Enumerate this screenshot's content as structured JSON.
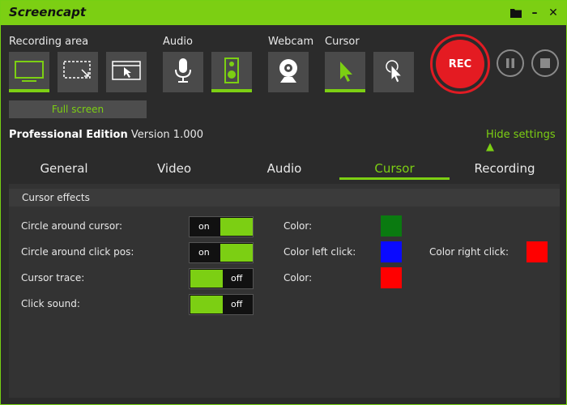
{
  "window": {
    "title": "Screencapt"
  },
  "titlebar": {
    "folder_icon": "folder-icon",
    "minimize": "–",
    "close": "✕"
  },
  "toolbar": {
    "recording_area_label": "Recording area",
    "audio_label": "Audio",
    "webcam_label": "Webcam",
    "cursor_label": "Cursor",
    "fullscreen_label": "Full screen",
    "rec_label": "REC",
    "icons": [
      "monitor-icon",
      "region-icon",
      "window-icon",
      "microphone-icon",
      "speaker-icon",
      "webcam-icon",
      "cursor-arrow-icon",
      "cursor-click-icon",
      "pause-icon",
      "stop-icon"
    ]
  },
  "edition": {
    "name": "Professional Edition",
    "version": "Version 1.000"
  },
  "hide_settings": "Hide settings ▲",
  "tabs": [
    {
      "label": "General"
    },
    {
      "label": "Video"
    },
    {
      "label": "Audio"
    },
    {
      "label": "Cursor"
    },
    {
      "label": "Recording"
    }
  ],
  "active_tab": "Cursor",
  "panel": {
    "title": "Cursor effects",
    "rows": [
      {
        "label": "Circle around cursor:",
        "state": "on"
      },
      {
        "label": "Circle around click pos:",
        "state": "on"
      },
      {
        "label": "Cursor trace:",
        "state": "off"
      },
      {
        "label": "Click sound:",
        "state": "off"
      }
    ],
    "colors": [
      {
        "label": "Color:",
        "value": "#0a7a10"
      },
      {
        "label": "Color left click:",
        "value": "#0a0aff"
      },
      {
        "label": "Color:",
        "value": "#ff0000"
      }
    ],
    "color_right_click": {
      "label": "Color right click:",
      "value": "#ff0000"
    }
  },
  "colors": {
    "accent": "#7ccf13",
    "rec": "#e41b22"
  }
}
